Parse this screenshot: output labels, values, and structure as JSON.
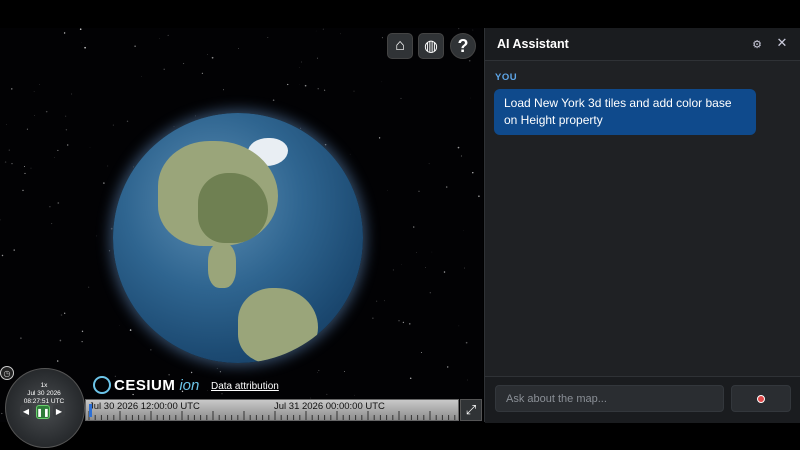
{
  "toolbar": {
    "home_icon": "home-icon",
    "globe_icon": "globe-icon",
    "help_label": "?"
  },
  "animation": {
    "speed": "1x",
    "date": "Jul 30 2026",
    "time": "08:27:51 UTC"
  },
  "logo": {
    "text": "CESIUM",
    "suffix": "ion"
  },
  "attribution": "Data attribution",
  "timeline": {
    "labels": [
      "Jul 30 2026 12:00:00 UTC",
      "Jul 31 2026 00:00:00 UTC"
    ]
  },
  "assistant": {
    "title": "AI Assistant",
    "messages": [
      {
        "role_label": "YOU",
        "text": "Load New York 3d tiles and add color base on Height property"
      }
    ],
    "input_placeholder": "Ask about the map..."
  },
  "colors": {
    "accent": "#0f4a8c",
    "role_label": "#5ea6e8",
    "panel_bg": "#1f2124"
  }
}
